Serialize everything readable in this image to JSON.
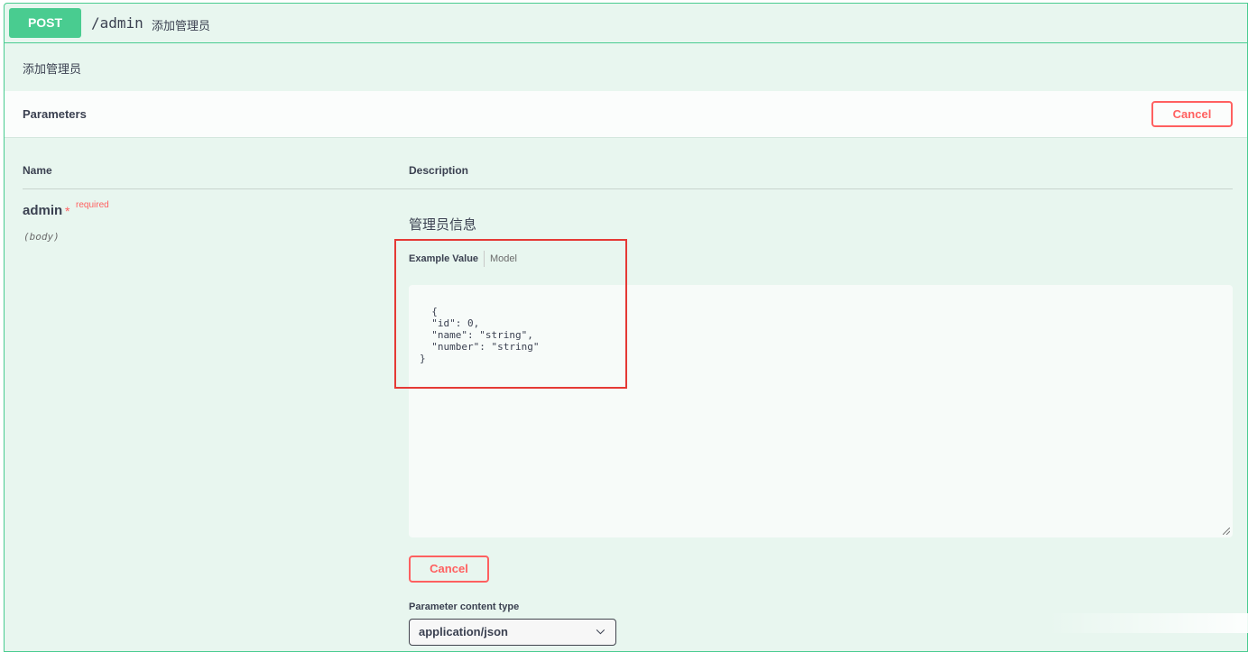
{
  "operation": {
    "method": "POST",
    "path": "/admin",
    "summary": "添加管理员",
    "description": "添加管理员"
  },
  "parameters": {
    "title": "Parameters",
    "cancel_label": "Cancel",
    "columns": {
      "name": "Name",
      "description": "Description"
    },
    "param": {
      "name": "admin",
      "required_star": "*",
      "required_text": "required",
      "in": "(body)",
      "description": "管理员信息"
    },
    "tabs": {
      "example": "Example Value",
      "model": "Model"
    },
    "example_body": "{\n  \"id\": 0,\n  \"name\": \"string\",\n  \"number\": \"string\"\n}",
    "cancel_bottom_label": "Cancel",
    "content_type_label": "Parameter content type",
    "content_type_value": "application/json"
  },
  "icons": {
    "select": "chevron-down-icon",
    "resize": "resize-grip-icon"
  },
  "colors": {
    "post_green": "#49cc90",
    "cancel_red": "#ff6060",
    "annotation_red": "#e53935",
    "block_bg": "#e8f6ef"
  }
}
